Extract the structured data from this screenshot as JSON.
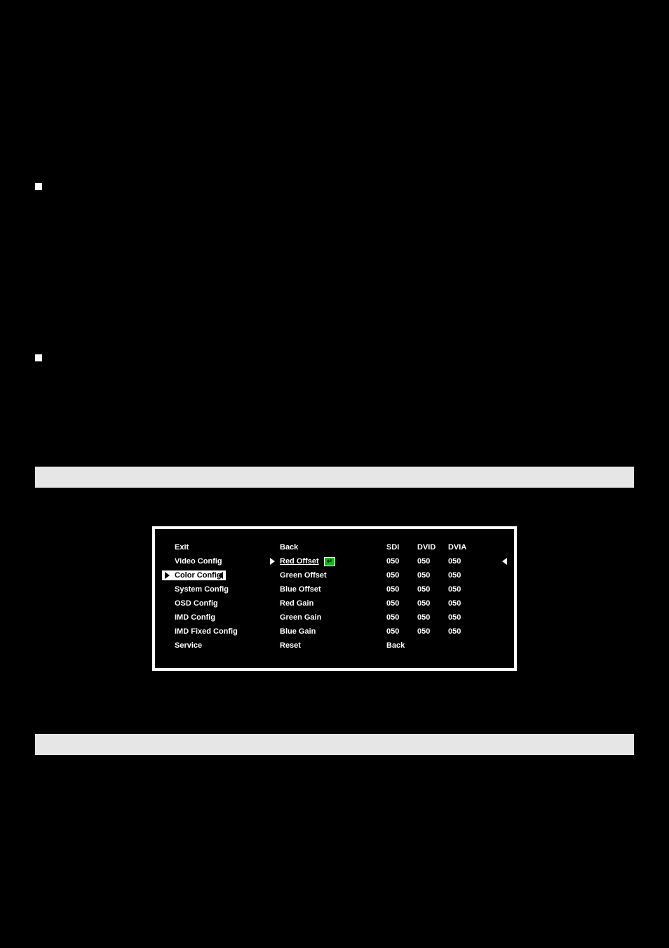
{
  "bullets": {
    "first": "",
    "second": ""
  },
  "submenu": {
    "leftHeader": "Exit",
    "left": [
      "Video Config",
      "Color Config",
      "System Config",
      "OSD Config",
      "IMD Config",
      "IMD Fixed Config",
      "Service"
    ],
    "leftSelectedIndex": 1,
    "midHeader": "Back",
    "mid": [
      "Red Offset",
      "Green Offset",
      "Blue Offset",
      "Red Gain",
      "Green Gain",
      "Blue Gain",
      "Reset"
    ],
    "midSelectedIndex": 0,
    "greenMarker": "↵",
    "rightHeaders": [
      "SDI",
      "DVID",
      "DVIA"
    ],
    "rows": [
      [
        "050",
        "050",
        "050"
      ],
      [
        "050",
        "050",
        "050"
      ],
      [
        "050",
        "050",
        "050"
      ],
      [
        "050",
        "050",
        "050"
      ],
      [
        "050",
        "050",
        "050"
      ],
      [
        "050",
        "050",
        "050"
      ]
    ],
    "resetRight": "Back"
  }
}
